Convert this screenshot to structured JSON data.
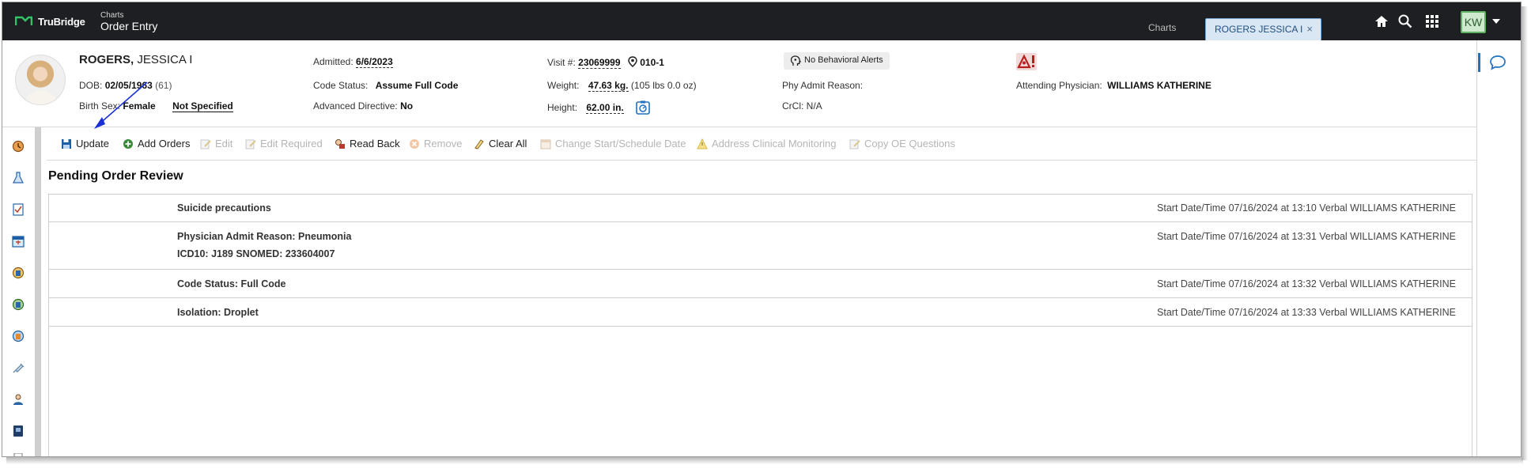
{
  "topbar": {
    "brand": "TruBridge",
    "crumb_small": "Charts",
    "crumb_title": "Order Entry",
    "tab_charts": "Charts",
    "tab_patient": "ROGERS JESSICA I",
    "tab_close": "×",
    "user_initials": "KW",
    "icons": [
      "home-icon",
      "search-icon",
      "apps-grid-icon",
      "chevron-down-icon"
    ]
  },
  "patient": {
    "last_name": "ROGERS,",
    "first_name": "JESSICA I",
    "dob_label": "DOB:",
    "dob": "02/05/1963",
    "age": "(61)",
    "birth_sex_label": "Birth Sex:",
    "birth_sex": "Female",
    "gender_identity": "Not Specified",
    "admitted_label": "Admitted:",
    "admitted": "6/6/2023",
    "code_status_label": "Code Status:",
    "code_status": "Assume Full Code",
    "advanced_directive_label": "Advanced Directive:",
    "advanced_directive": "No",
    "visit_label": "Visit #:",
    "visit": "23069999",
    "location": "010-1",
    "weight_label": "Weight:",
    "weight": "47.63 kg.",
    "weight_alt": "(105 lbs 0.0 oz)",
    "height_label": "Height:",
    "height": "62.00 in.",
    "behavioral_alert": "No Behavioral Alerts",
    "phy_admit_reason_label": "Phy Admit Reason:",
    "crcl_label": "CrCl:",
    "crcl": "N/A",
    "attending_label": "Attending Physician:",
    "attending": "WILLIAMS KATHERINE"
  },
  "toolbar": {
    "update": "Update",
    "add_orders": "Add Orders",
    "edit": "Edit",
    "edit_required": "Edit Required",
    "read_back": "Read Back",
    "remove": "Remove",
    "clear_all": "Clear All",
    "change_start": "Change Start/Schedule Date",
    "address_clinical": "Address Clinical Monitoring",
    "copy_oe": "Copy OE Questions"
  },
  "main": {
    "title": "Pending Order Review",
    "orders": [
      {
        "name": "Suicide precautions",
        "detail": "",
        "start": "Start Date/Time 07/16/2024 at 13:10 Verbal WILLIAMS KATHERINE"
      },
      {
        "name": "Physician Admit Reason: Pneumonia",
        "detail": "ICD10: J189 SNOMED: 233604007",
        "start": "Start Date/Time 07/16/2024 at 13:31 Verbal WILLIAMS KATHERINE"
      },
      {
        "name": "Code Status: Full Code",
        "detail": "",
        "start": "Start Date/Time 07/16/2024 at 13:32 Verbal WILLIAMS KATHERINE"
      },
      {
        "name": "Isolation: Droplet",
        "detail": "",
        "start": "Start Date/Time 07/16/2024 at 13:33 Verbal WILLIAMS KATHERINE"
      }
    ]
  },
  "colors": {
    "topbar": "#1d1f22",
    "accent": "#1d72c4",
    "tab_active": "#d9e7f4",
    "annotation_arrow": "#1a2fd6"
  }
}
